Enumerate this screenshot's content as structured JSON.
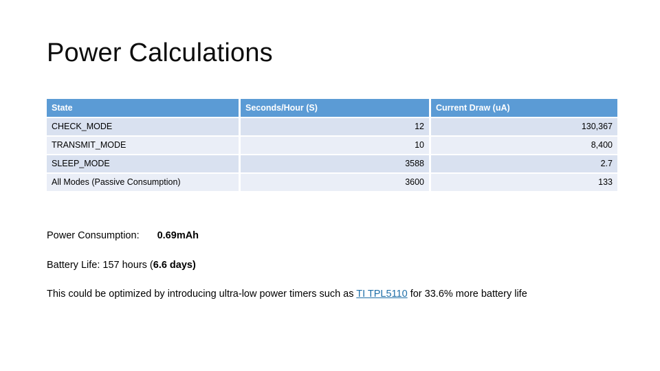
{
  "slide": {
    "title": "Power Calculations"
  },
  "table": {
    "columns": [
      "State",
      "Seconds/Hour (S)",
      "Current Draw (uA)"
    ],
    "rows": [
      {
        "state": "CHECK_MODE",
        "seconds": "12",
        "current": "130,367"
      },
      {
        "state": "TRANSMIT_MODE",
        "seconds": "10",
        "current": "8,400"
      },
      {
        "state": "SLEEP_MODE",
        "seconds": "3588",
        "current": "2.7"
      },
      {
        "state": "All Modes (Passive Consumption)",
        "seconds": "3600",
        "current": "133"
      }
    ],
    "header_background": "#5B9BD5",
    "row_background_odd": "#D9E1F0",
    "row_background_even": "#EAEEF7",
    "header_text_color": "#FFFFFF"
  },
  "notes": {
    "power_label": "Power Consumption:",
    "power_value": "0.69mAh",
    "battery_prefix": "Battery Life: 157 hours (",
    "battery_value": "6.6 days",
    "battery_suffix": ")",
    "optimize_prefix": "This could be optimized by introducing ultra-low power timers such as ",
    "optimize_link": "TI TPL5110",
    "optimize_suffix": " for 33.6% more battery life",
    "link_color": "#1F6FA8"
  }
}
